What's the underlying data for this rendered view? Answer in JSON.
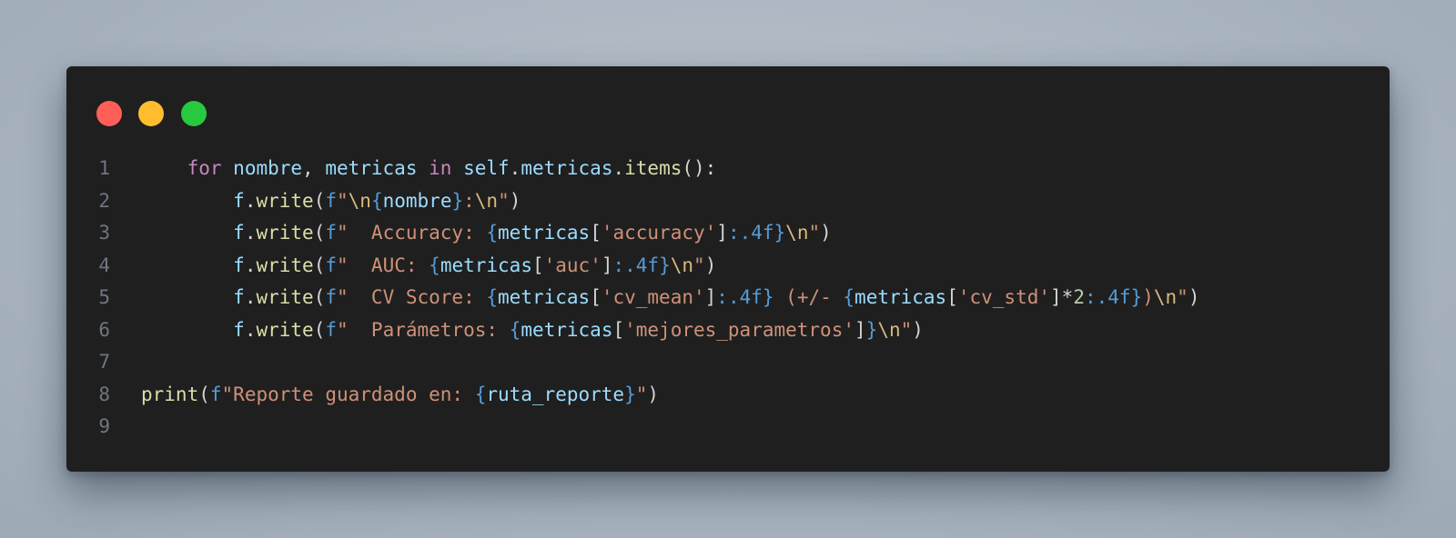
{
  "window": {
    "traffic_lights": [
      {
        "name": "close",
        "color": "#ff5f56"
      },
      {
        "name": "minimize",
        "color": "#ffbd2e"
      },
      {
        "name": "zoom",
        "color": "#27c93f"
      }
    ]
  },
  "code": {
    "lines": [
      {
        "number": "1",
        "indent": "    ",
        "tokens": [
          {
            "t": "for",
            "c": "kw"
          },
          {
            "t": " ",
            "c": "pn"
          },
          {
            "t": "nombre",
            "c": "var"
          },
          {
            "t": ", ",
            "c": "pn"
          },
          {
            "t": "metricas",
            "c": "var"
          },
          {
            "t": " ",
            "c": "pn"
          },
          {
            "t": "in",
            "c": "kw"
          },
          {
            "t": " ",
            "c": "pn"
          },
          {
            "t": "self",
            "c": "var"
          },
          {
            "t": ".",
            "c": "pn"
          },
          {
            "t": "metricas",
            "c": "var"
          },
          {
            "t": ".",
            "c": "pn"
          },
          {
            "t": "items",
            "c": "fn"
          },
          {
            "t": "():",
            "c": "pn"
          }
        ]
      },
      {
        "number": "2",
        "indent": "        ",
        "tokens": [
          {
            "t": "f",
            "c": "var"
          },
          {
            "t": ".",
            "c": "pn"
          },
          {
            "t": "write",
            "c": "fn"
          },
          {
            "t": "(",
            "c": "pn"
          },
          {
            "t": "f",
            "c": "pfx"
          },
          {
            "t": "\"",
            "c": "str"
          },
          {
            "t": "\\n",
            "c": "esc"
          },
          {
            "t": "{",
            "c": "brace"
          },
          {
            "t": "nombre",
            "c": "var"
          },
          {
            "t": "}",
            "c": "brace"
          },
          {
            "t": ":",
            "c": "str"
          },
          {
            "t": "\\n",
            "c": "esc"
          },
          {
            "t": "\"",
            "c": "str"
          },
          {
            "t": ")",
            "c": "pn"
          }
        ]
      },
      {
        "number": "3",
        "indent": "        ",
        "tokens": [
          {
            "t": "f",
            "c": "var"
          },
          {
            "t": ".",
            "c": "pn"
          },
          {
            "t": "write",
            "c": "fn"
          },
          {
            "t": "(",
            "c": "pn"
          },
          {
            "t": "f",
            "c": "pfx"
          },
          {
            "t": "\"  Accuracy: ",
            "c": "str"
          },
          {
            "t": "{",
            "c": "brace"
          },
          {
            "t": "metricas",
            "c": "var"
          },
          {
            "t": "[",
            "c": "pn"
          },
          {
            "t": "'accuracy'",
            "c": "str"
          },
          {
            "t": "]",
            "c": "pn"
          },
          {
            "t": ":.4f",
            "c": "brace"
          },
          {
            "t": "}",
            "c": "brace"
          },
          {
            "t": "\\n",
            "c": "esc"
          },
          {
            "t": "\"",
            "c": "str"
          },
          {
            "t": ")",
            "c": "pn"
          }
        ]
      },
      {
        "number": "4",
        "indent": "        ",
        "tokens": [
          {
            "t": "f",
            "c": "var"
          },
          {
            "t": ".",
            "c": "pn"
          },
          {
            "t": "write",
            "c": "fn"
          },
          {
            "t": "(",
            "c": "pn"
          },
          {
            "t": "f",
            "c": "pfx"
          },
          {
            "t": "\"  AUC: ",
            "c": "str"
          },
          {
            "t": "{",
            "c": "brace"
          },
          {
            "t": "metricas",
            "c": "var"
          },
          {
            "t": "[",
            "c": "pn"
          },
          {
            "t": "'auc'",
            "c": "str"
          },
          {
            "t": "]",
            "c": "pn"
          },
          {
            "t": ":.4f",
            "c": "brace"
          },
          {
            "t": "}",
            "c": "brace"
          },
          {
            "t": "\\n",
            "c": "esc"
          },
          {
            "t": "\"",
            "c": "str"
          },
          {
            "t": ")",
            "c": "pn"
          }
        ]
      },
      {
        "number": "5",
        "indent": "        ",
        "tokens": [
          {
            "t": "f",
            "c": "var"
          },
          {
            "t": ".",
            "c": "pn"
          },
          {
            "t": "write",
            "c": "fn"
          },
          {
            "t": "(",
            "c": "pn"
          },
          {
            "t": "f",
            "c": "pfx"
          },
          {
            "t": "\"  CV Score: ",
            "c": "str"
          },
          {
            "t": "{",
            "c": "brace"
          },
          {
            "t": "metricas",
            "c": "var"
          },
          {
            "t": "[",
            "c": "pn"
          },
          {
            "t": "'cv_mean'",
            "c": "str"
          },
          {
            "t": "]",
            "c": "pn"
          },
          {
            "t": ":.4f",
            "c": "brace"
          },
          {
            "t": "}",
            "c": "brace"
          },
          {
            "t": " (+/- ",
            "c": "str"
          },
          {
            "t": "{",
            "c": "brace"
          },
          {
            "t": "metricas",
            "c": "var"
          },
          {
            "t": "[",
            "c": "pn"
          },
          {
            "t": "'cv_std'",
            "c": "str"
          },
          {
            "t": "]*",
            "c": "pn"
          },
          {
            "t": "2",
            "c": "num"
          },
          {
            "t": ":.4f",
            "c": "brace"
          },
          {
            "t": "}",
            "c": "brace"
          },
          {
            "t": ")",
            "c": "str"
          },
          {
            "t": "\\n",
            "c": "esc"
          },
          {
            "t": "\"",
            "c": "str"
          },
          {
            "t": ")",
            "c": "pn"
          }
        ]
      },
      {
        "number": "6",
        "indent": "        ",
        "tokens": [
          {
            "t": "f",
            "c": "var"
          },
          {
            "t": ".",
            "c": "pn"
          },
          {
            "t": "write",
            "c": "fn"
          },
          {
            "t": "(",
            "c": "pn"
          },
          {
            "t": "f",
            "c": "pfx"
          },
          {
            "t": "\"  Parámetros: ",
            "c": "str"
          },
          {
            "t": "{",
            "c": "brace"
          },
          {
            "t": "metricas",
            "c": "var"
          },
          {
            "t": "[",
            "c": "pn"
          },
          {
            "t": "'mejores_parametros'",
            "c": "str"
          },
          {
            "t": "]",
            "c": "pn"
          },
          {
            "t": "}",
            "c": "brace"
          },
          {
            "t": "\\n",
            "c": "esc"
          },
          {
            "t": "\"",
            "c": "str"
          },
          {
            "t": ")",
            "c": "pn"
          }
        ]
      },
      {
        "number": "7",
        "indent": "",
        "tokens": []
      },
      {
        "number": "8",
        "indent": "",
        "tokens": [
          {
            "t": "print",
            "c": "fn"
          },
          {
            "t": "(",
            "c": "pn"
          },
          {
            "t": "f",
            "c": "pfx"
          },
          {
            "t": "\"Reporte guardado en: ",
            "c": "str"
          },
          {
            "t": "{",
            "c": "brace"
          },
          {
            "t": "ruta_reporte",
            "c": "var"
          },
          {
            "t": "}",
            "c": "brace"
          },
          {
            "t": "\"",
            "c": "str"
          },
          {
            "t": ")",
            "c": "pn"
          }
        ]
      },
      {
        "number": "9",
        "indent": "",
        "tokens": []
      }
    ]
  }
}
